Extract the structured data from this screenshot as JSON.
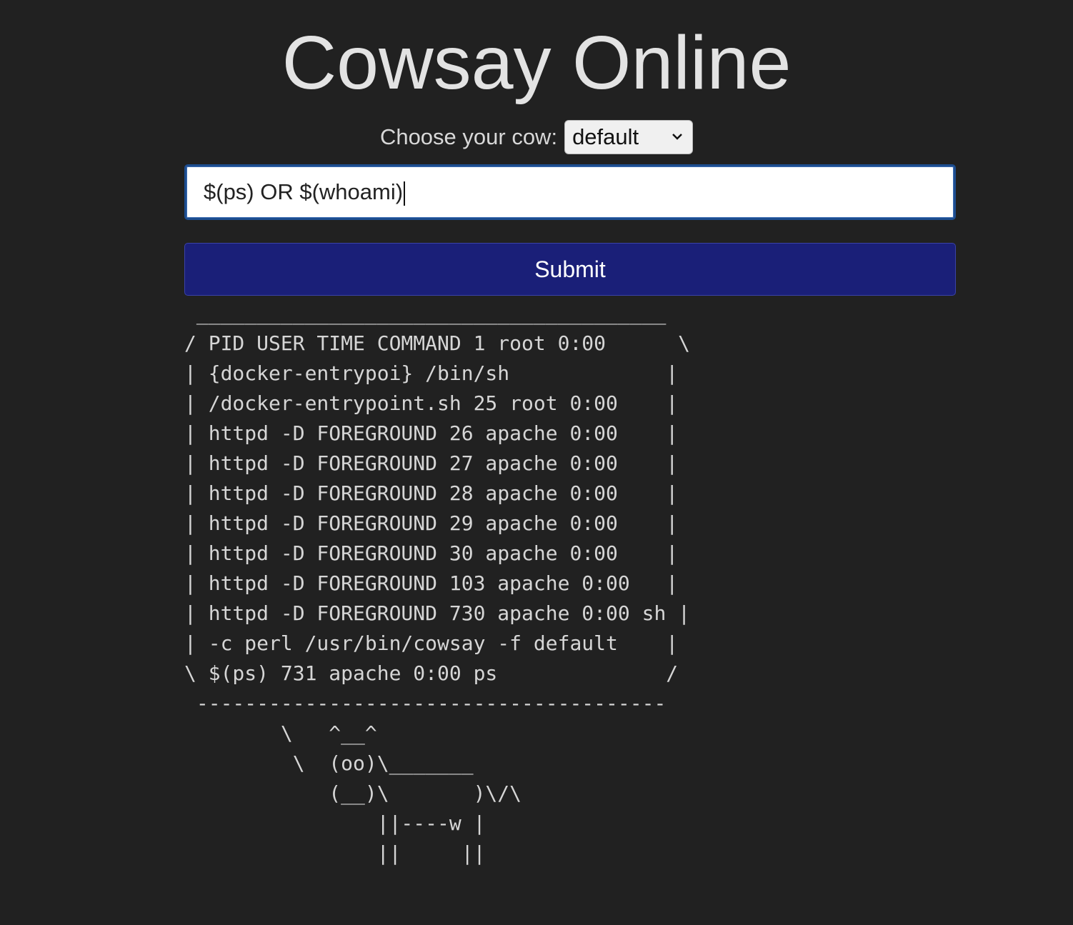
{
  "page": {
    "title": "Cowsay Online"
  },
  "cow_select": {
    "label": "Choose your cow:",
    "selected": "default"
  },
  "message_input": {
    "value": "$(ps) OR $(whoami)"
  },
  "submit": {
    "label": "Submit"
  },
  "output": {
    "text": " _______________________________________\n/ PID USER TIME COMMAND 1 root 0:00      \\\n| {docker-entrypoi} /bin/sh             |\n| /docker-entrypoint.sh 25 root 0:00    |\n| httpd -D FOREGROUND 26 apache 0:00    |\n| httpd -D FOREGROUND 27 apache 0:00    |\n| httpd -D FOREGROUND 28 apache 0:00    |\n| httpd -D FOREGROUND 29 apache 0:00    |\n| httpd -D FOREGROUND 30 apache 0:00    |\n| httpd -D FOREGROUND 103 apache 0:00   |\n| httpd -D FOREGROUND 730 apache 0:00 sh |\n| -c perl /usr/bin/cowsay -f default    |\n\\ $(ps) 731 apache 0:00 ps              /\n ---------------------------------------\n        \\   ^__^\n         \\  (oo)\\_______\n            (__)\\       )\\/\\\n                ||----w |\n                ||     ||"
  },
  "icons": {
    "select_arrow": "chevron-down-icon"
  },
  "colors": {
    "background": "#212121",
    "submit_button": "#1a1f78",
    "input_border": "#1d4d8f"
  }
}
